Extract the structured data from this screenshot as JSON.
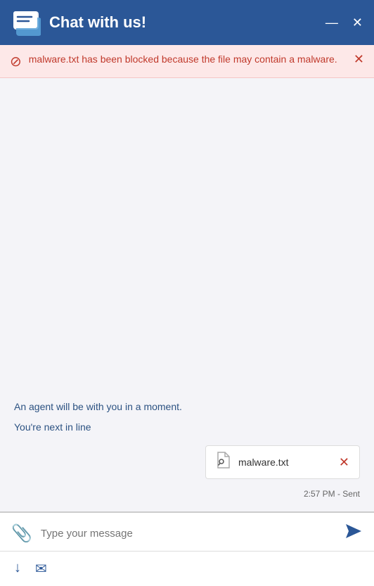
{
  "titleBar": {
    "title": "Chat with us!",
    "minimizeLabel": "—",
    "closeLabel": "✕"
  },
  "warningBanner": {
    "icon": "⊙",
    "text": "malware.txt has been blocked because the file may contain a malware.",
    "closeLabel": "✕"
  },
  "chat": {
    "agentMessage": "An agent will be with you in a moment.",
    "queueMessage": "You're next in line",
    "attachment": {
      "filename": "malware.txt",
      "removeLabel": "✕"
    },
    "timestamp": "2:57 PM - Sent"
  },
  "inputArea": {
    "placeholder": "Type your message",
    "attachIcon": "📎",
    "sendIcon": "➤"
  },
  "bottomToolbar": {
    "downloadIcon": "↓",
    "emailIcon": "✉"
  }
}
